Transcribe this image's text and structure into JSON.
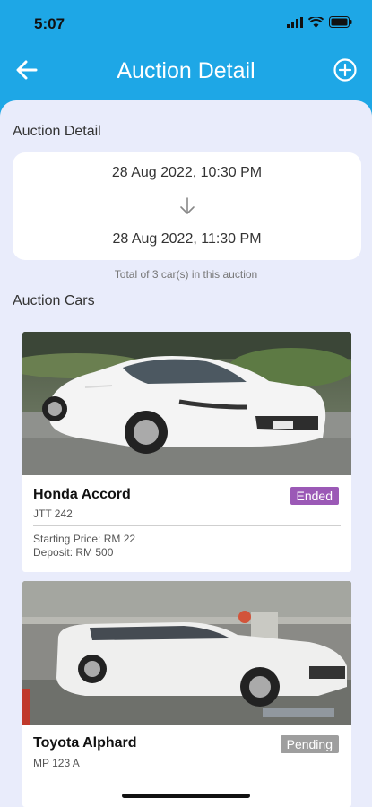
{
  "status_bar": {
    "time": "5:07",
    "icons": [
      "signal-icon",
      "wifi-icon",
      "battery-icon"
    ]
  },
  "nav": {
    "title": "Auction Detail",
    "back_icon": "arrow-left-icon",
    "add_icon": "plus-circle-icon"
  },
  "auction": {
    "section_label": "Auction Detail",
    "start": "28 Aug 2022, 10:30 PM",
    "end": "28 Aug 2022, 11:30 PM",
    "total_note": "Total of 3 car(s) in this auction"
  },
  "cars_section_label": "Auction Cars",
  "cars": [
    {
      "name": "Honda Accord",
      "plate": "JTT 242",
      "status": "Ended",
      "status_color": "#9b59b6",
      "starting_price": "Starting Price: RM 22",
      "deposit": "Deposit: RM 500"
    },
    {
      "name": "Toyota Alphard",
      "plate": "MP 123 A",
      "status": "Pending",
      "status_color": "#9e9e9e"
    }
  ],
  "colors": {
    "header": "#1ea7e6",
    "sheet": "#e9ecfb"
  }
}
